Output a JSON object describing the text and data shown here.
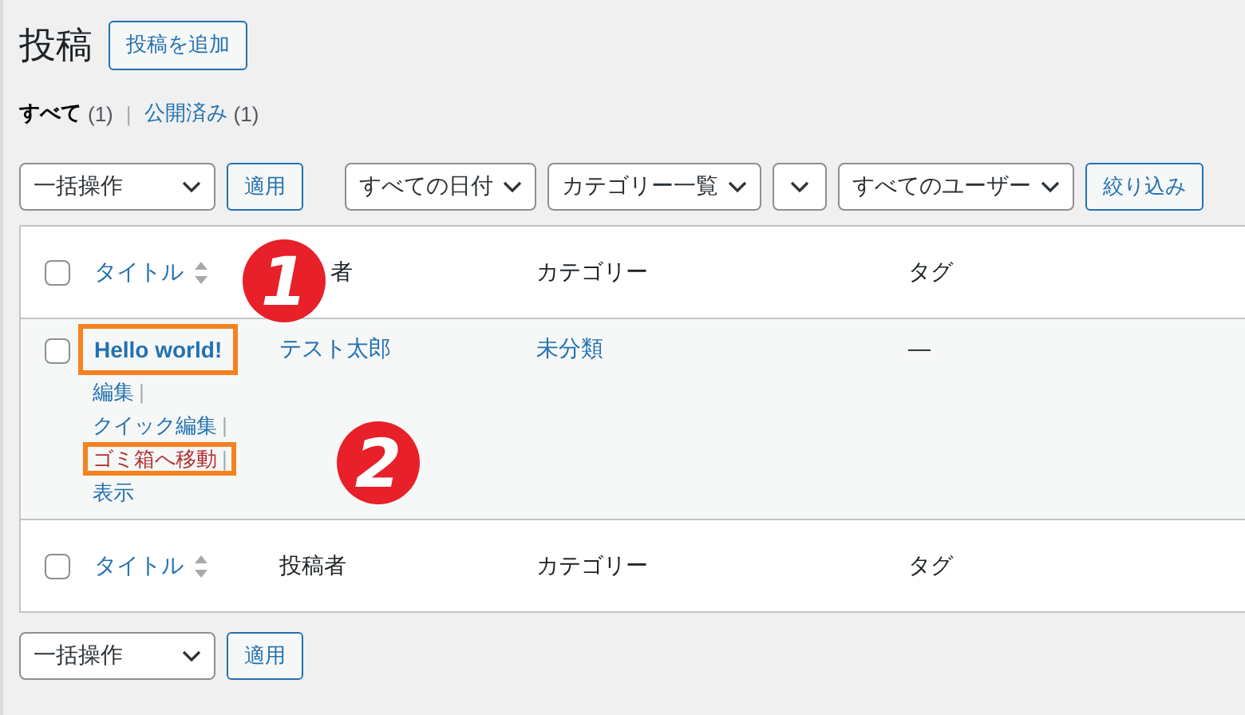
{
  "page": {
    "title": "投稿",
    "add_button": "投稿を追加"
  },
  "filters": [
    {
      "label": "すべて",
      "count": "(1)",
      "selected": true,
      "separator": "|"
    },
    {
      "label": "公開済み",
      "count": "(1)",
      "selected": false
    }
  ],
  "top_toolbar": {
    "bulk_action": "一括操作",
    "apply": "適用",
    "selects": [
      {
        "kind": "labeled",
        "label": "すべての日付"
      },
      {
        "kind": "labeled",
        "label": "カテゴリー一覧"
      },
      {
        "kind": "empty"
      },
      {
        "kind": "labeled",
        "label": "すべてのユーザー"
      }
    ],
    "filter_button": "絞り込み"
  },
  "table": {
    "header_checked": false,
    "columns": [
      {
        "label": "タイトル",
        "sortable": true
      },
      {
        "label": "者",
        "sortable": false
      },
      {
        "label": "カテゴリー",
        "sortable": false
      },
      {
        "label": "タグ",
        "sortable": false
      }
    ],
    "rows": [
      {
        "checked": false,
        "title": "Hello world!",
        "title_highlighted": true,
        "author": "テスト太郎",
        "category": "未分類",
        "tags": "—",
        "actions": [
          {
            "label": "編集",
            "kind": "normal",
            "separator": "|",
            "highlighted": false
          },
          {
            "label": "クイック編集",
            "kind": "normal",
            "separator": "|",
            "highlighted": false
          },
          {
            "label": "ゴミ箱へ移動",
            "kind": "delete",
            "separator": "|",
            "highlighted": true
          },
          {
            "label": "表示",
            "kind": "normal",
            "highlighted": false
          }
        ]
      }
    ],
    "footer_checked": false,
    "footer_columns": [
      {
        "label": "タイトル",
        "sortable": true
      },
      {
        "label": "投稿者",
        "sortable": false
      },
      {
        "label": "カテゴリー",
        "sortable": false
      },
      {
        "label": "タグ",
        "sortable": false
      }
    ]
  },
  "bottom_toolbar": {
    "bulk_action": "一括操作",
    "apply": "適用"
  },
  "annotations": [
    {
      "label": "1"
    },
    {
      "label": "2"
    }
  ]
}
